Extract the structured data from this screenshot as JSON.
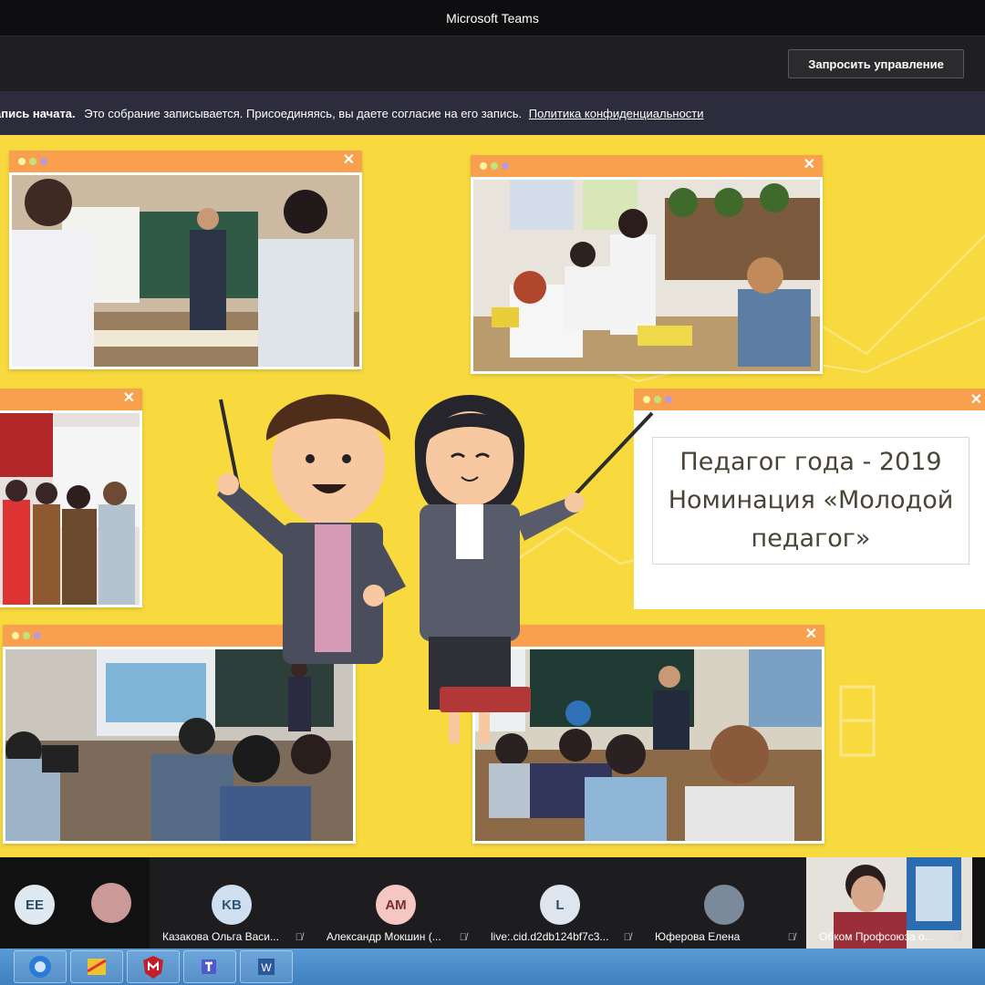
{
  "window": {
    "title": "Microsoft Teams"
  },
  "toolbar": {
    "request_control_label": "Запросить управление"
  },
  "banner": {
    "bold_text": "апись начата.",
    "text": "Это собрание записывается. Присоединяясь, вы даете согласие на его запись.",
    "link_text": "Политика конфиденциальности"
  },
  "slide": {
    "title_line1": "Педагог года - 2019",
    "title_line2": "Номинация «Молодой",
    "title_line3": "педагог»"
  },
  "participants": [
    {
      "initials": "EE",
      "name": "",
      "avatar_color": "#dfe9f2",
      "text_color": "#2b4b6b"
    },
    {
      "initials": "",
      "name": "",
      "avatar_color": "#c99",
      "text_color": "#fff"
    },
    {
      "initials": "KB",
      "name": "Казакова Ольга Васи...",
      "avatar_color": "#cfdfef",
      "text_color": "#2f557b"
    },
    {
      "initials": "AM",
      "name": "Александр Мокшин (...",
      "avatar_color": "#f4c7c3",
      "text_color": "#7b2d2d"
    },
    {
      "initials": "L",
      "name": "live:.cid.d2db124bf7c3...",
      "avatar_color": "#dde6ef",
      "text_color": "#2c4a6a"
    },
    {
      "initials": "",
      "name": "Юферова Елена",
      "avatar_color": "#7a8a9a",
      "text_color": "#fff"
    },
    {
      "initials": "",
      "name": "Обком Профсоюза о...",
      "avatar_color": "#a77",
      "text_color": "#fff"
    }
  ],
  "icons": {
    "mic_off": "mic-off-icon",
    "window_close": "close-icon"
  },
  "colors": {
    "stage_bg": "#f8da3f",
    "window_bar": "#f8a04e",
    "banner_bg": "#2d2c3d"
  }
}
